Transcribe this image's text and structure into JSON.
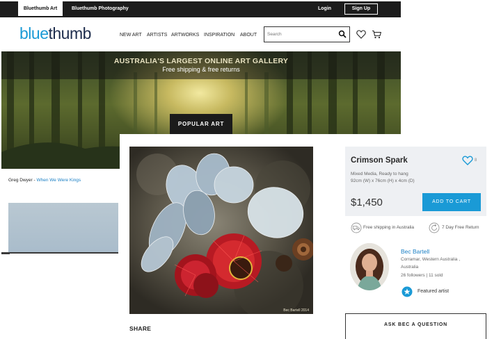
{
  "topbar": {
    "tab_art": "Bluethumb Art",
    "tab_photography": "Bluethumb Photography",
    "login": "Login",
    "signup": "Sign Up"
  },
  "header": {
    "logo_part1": "blue",
    "logo_part2": "thumb",
    "nav": [
      "NEW ART",
      "ARTISTS",
      "ARTWORKS",
      "INSPIRATION",
      "ABOUT"
    ],
    "search_placeholder": "Search"
  },
  "hero": {
    "title": "AUSTRALIA'S LARGEST ONLINE ART GALLERY",
    "subtitle": "Free shipping & free returns",
    "button": "POPULAR ART"
  },
  "left_column": {
    "artist": "Greg Dwyer",
    "separator": " - ",
    "work_link": "When We Were Kings"
  },
  "artwork": {
    "signature": "Bec Bartell 2014",
    "share_label": "SHARE"
  },
  "product": {
    "title": "Crimson Spark",
    "favourites": "8",
    "medium": "Mixed Media, Ready to hang",
    "dimensions": "92cm (W) x 76cm (H) x 4cm (D)",
    "price": "$1,450",
    "add_to_cart": "ADD TO CART",
    "perk_shipping": "Free shipping in Australia",
    "perk_returns": "7 Day Free Return"
  },
  "artist": {
    "name": "Bec Bartell",
    "location_line1": "Corramar, Western Australia ,",
    "location_line2": "Australia",
    "stats": "26 followers | 11 sold",
    "featured": "Featured artist",
    "ask_button": "ASK BEC A QUESTION"
  },
  "colors": {
    "brand_blue": "#1a9ad6",
    "logo_navy": "#1e2d4d",
    "topbar": "#1c1c1c"
  }
}
